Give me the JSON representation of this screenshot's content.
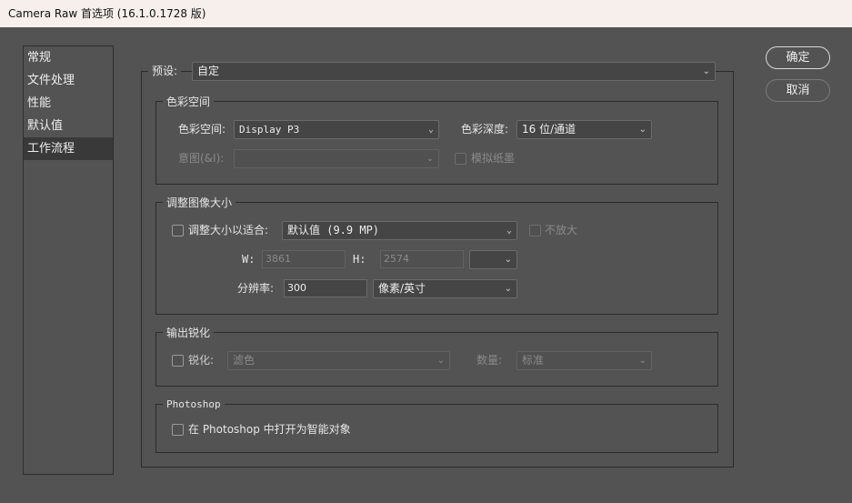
{
  "window": {
    "title": "Camera Raw 首选项  (16.1.0.1728 版)"
  },
  "sidebar": {
    "items": [
      {
        "label": "常规"
      },
      {
        "label": "文件处理"
      },
      {
        "label": "性能"
      },
      {
        "label": "默认值"
      },
      {
        "label": "工作流程",
        "selected": true
      }
    ]
  },
  "preset": {
    "label": "预设:",
    "value": "自定"
  },
  "color_space": {
    "title": "色彩空间",
    "space_label": "色彩空间:",
    "space_value": "Display P3",
    "depth_label": "色彩深度:",
    "depth_value": "16 位/通道",
    "intent_label": "意图(&I):",
    "intent_value": "",
    "simulate_paper_label": "模拟纸墨",
    "simulate_paper_checked": false
  },
  "resize": {
    "title": "调整图像大小",
    "resize_label": "调整大小以适合:",
    "resize_checked": false,
    "resize_value": "默认值 (9.9 MP)",
    "no_enlarge_label": "不放大",
    "no_enlarge_checked": false,
    "w_label": "W:",
    "w_value": "3861",
    "h_label": "H:",
    "h_value": "2574",
    "unit_value": "",
    "resolution_label": "分辨率:",
    "resolution_value": "300",
    "resolution_unit": "像素/英寸"
  },
  "sharpen": {
    "title": "输出锐化",
    "sharpen_label": "锐化:",
    "sharpen_checked": false,
    "sharpen_value": "滤色",
    "amount_label": "数量:",
    "amount_value": "标准"
  },
  "photoshop": {
    "title": "Photoshop",
    "smart_object_label": "在 Photoshop 中打开为智能对象",
    "smart_object_checked": false
  },
  "buttons": {
    "ok": "确定",
    "cancel": "取消"
  },
  "icons": {
    "dropdown": "chevron-down-icon"
  }
}
